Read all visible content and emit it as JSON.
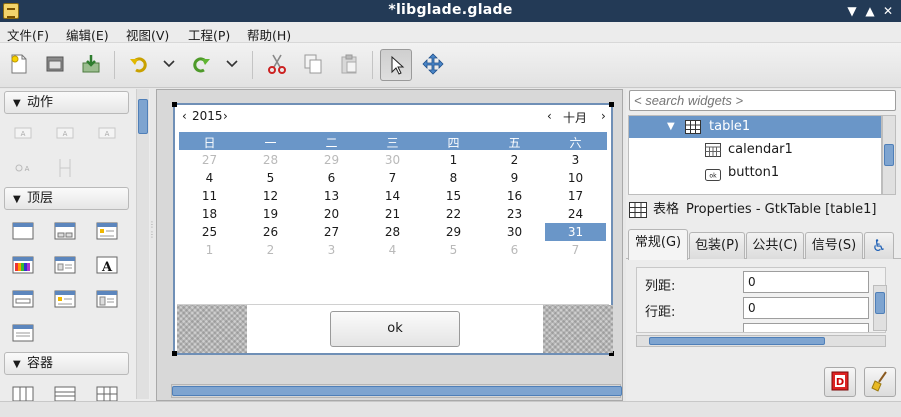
{
  "window": {
    "title": "*libglade.glade"
  },
  "menu": [
    {
      "id": "file",
      "label": "文件(F)"
    },
    {
      "id": "edit",
      "label": "编辑(E)"
    },
    {
      "id": "view",
      "label": "视图(V)"
    },
    {
      "id": "project",
      "label": "工程(P)"
    },
    {
      "id": "help",
      "label": "帮助(H)"
    }
  ],
  "palette": {
    "groups": [
      "动作",
      "顶层",
      "容器"
    ]
  },
  "calendar": {
    "year": "2015",
    "month": "十月",
    "weekdays": [
      "日",
      "一",
      "二",
      "三",
      "四",
      "五",
      "六"
    ],
    "rows": [
      [
        "27",
        "28",
        "29",
        "30",
        "1",
        "2",
        "3"
      ],
      [
        "4",
        "5",
        "6",
        "7",
        "8",
        "9",
        "10"
      ],
      [
        "11",
        "12",
        "13",
        "14",
        "15",
        "16",
        "17"
      ],
      [
        "18",
        "19",
        "20",
        "21",
        "22",
        "23",
        "24"
      ],
      [
        "25",
        "26",
        "27",
        "28",
        "29",
        "30",
        "31"
      ],
      [
        "1",
        "2",
        "3",
        "4",
        "5",
        "6",
        "7"
      ]
    ],
    "selected": "31"
  },
  "ok_button": {
    "label": "ok"
  },
  "search": {
    "placeholder": "< search widgets >"
  },
  "inspector": {
    "items": [
      "table1",
      "calendar1",
      "button1"
    ]
  },
  "properties": {
    "icon_label": "表格",
    "header": "Properties - GtkTable [table1]",
    "tabs": [
      "常规(G)",
      "包装(P)",
      "公共(C)",
      "信号(S)"
    ],
    "fields": [
      {
        "label": "列距:",
        "value": "0"
      },
      {
        "label": "行距:",
        "value": "0"
      }
    ]
  }
}
